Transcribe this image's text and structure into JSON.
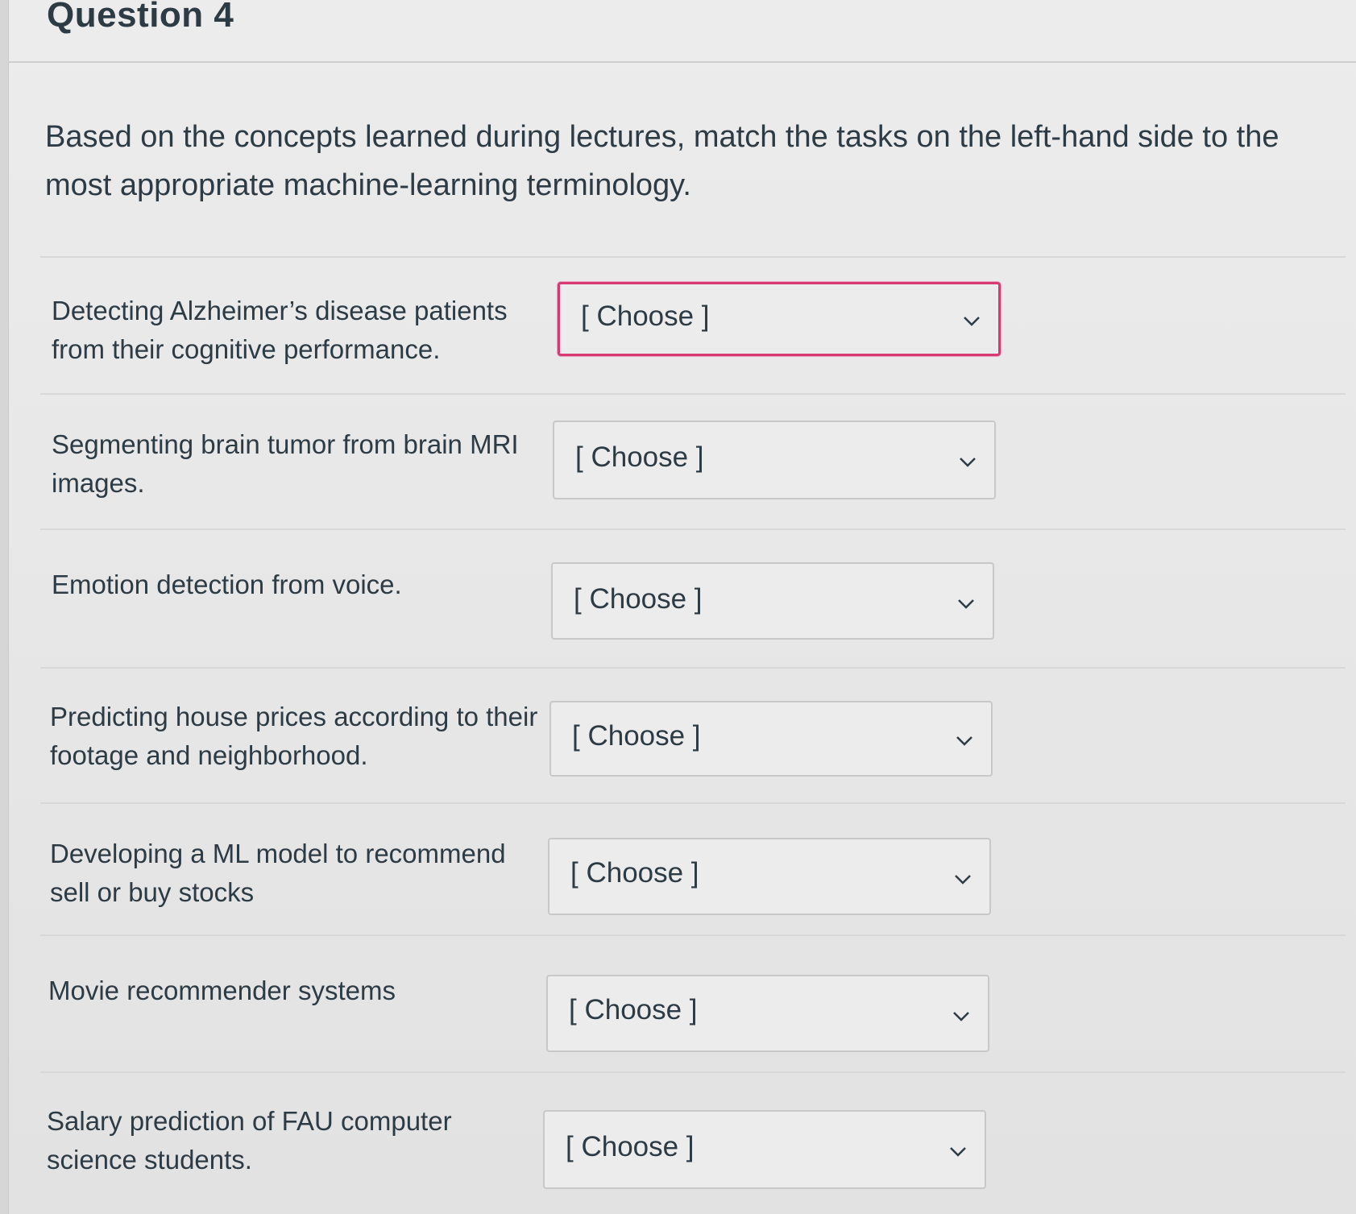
{
  "question": {
    "title": "Question 4",
    "prompt": "Based on the concepts learned during lectures, match the tasks on the left-hand side to the most appropriate machine-learning terminology."
  },
  "rows": [
    {
      "label": "Detecting Alzheimer’s disease patients from their cognitive performance.",
      "select_value": "[ Choose ]"
    },
    {
      "label": "Segmenting brain tumor from brain MRI images.",
      "select_value": "[ Choose ]"
    },
    {
      "label": "Emotion detection from voice.",
      "select_value": "[ Choose ]"
    },
    {
      "label": "Predicting house prices according to their footage and neighborhood.",
      "select_value": "[ Choose ]"
    },
    {
      "label": "Developing a ML model to recommend sell or buy stocks",
      "select_value": "[ Choose ]"
    },
    {
      "label": "Movie recommender systems",
      "select_value": "[ Choose ]"
    },
    {
      "label": "Salary prediction of FAU computer science students.",
      "select_value": "[ Choose ]"
    }
  ],
  "icons": {
    "select_chevron": "chevron-down-icon"
  },
  "colors": {
    "focus_border": "#d63a73",
    "text": "#2d3b45"
  }
}
